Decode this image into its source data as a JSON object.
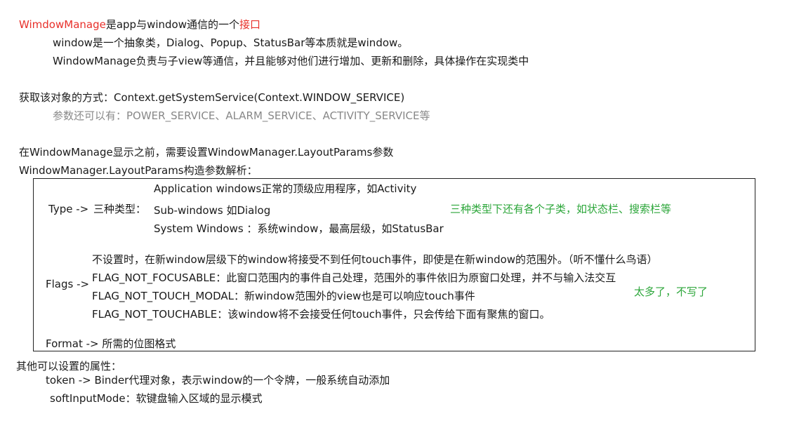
{
  "intro": {
    "title_part1": "WimdowManage",
    "title_part2": "是app与window通信的一个",
    "title_part3": "接口",
    "line1": "window是一个抽象类，Dialog、Popup、StatusBar等本质就是window。",
    "line2": "WindowManage负责与子view等通信，并且能够对他们进行增加、更新和删除，具体操作在实现类中"
  },
  "obtain": {
    "line": "获取该对象的方式：Context.getSystemService(Context.WINDOW_SERVICE)",
    "params": "参数还可以有：POWER_SERVICE、ALARM_SERVICE、ACTIVITY_SERVICE等"
  },
  "layout": {
    "line1": "在WindowManage显示之前，需要设置WindowManager.LayoutParams参数",
    "line2": "WindowManager.LayoutParams构造参数解析："
  },
  "box": {
    "type_label": "Type ->",
    "type_sub": "三种类型：",
    "type_items": [
      "Application windows正常的顶级应用程序，如Activity",
      "Sub-windows 如Dialog",
      "System Windows ：系统window，最高层级，如StatusBar"
    ],
    "type_note": "三种类型下还有各个子类，如状态栏、搜索栏等",
    "flags_label": "Flags ->",
    "flags_items": [
      "不设置时，在新window层级下的window将接受不到任何touch事件，即使是在新window的范围外。（听不懂什么鸟语）",
      "FLAG_NOT_FOCUSABLE：此窗口范围内的事件自己处理，范围外的事件依旧为原窗口处理，并不与输入法交互",
      "FLAG_NOT_TOUCH_MODAL：新window范围外的view也是可以响应touch事件",
      "FLAG_NOT_TOUCHABLE：该window将不会接受任何touch事件，只会传给下面有聚焦的窗口。"
    ],
    "flags_note": "太多了，不写了",
    "format_line": "Format -> 所需的位图格式"
  },
  "other": {
    "title": "其他可以设置的属性：",
    "token": "token  -> Binder代理对象，表示window的一个令牌，一般系统自动添加",
    "soft": "softInputMode：软键盘输入区域的显示模式"
  },
  "colors": {
    "accent_red": "#e8302a",
    "note_green": "#2ca63a",
    "muted_gray": "#888888"
  }
}
